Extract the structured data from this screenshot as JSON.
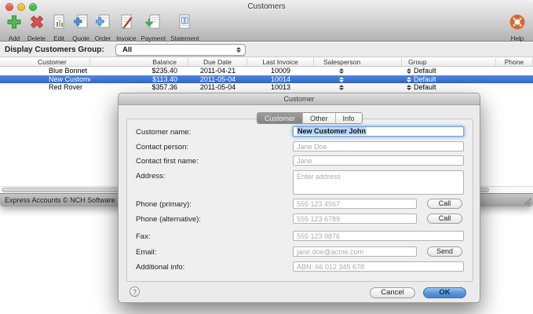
{
  "window": {
    "title": "Customers"
  },
  "toolbar": {
    "items": [
      {
        "label": "Add",
        "icon": "add-icon"
      },
      {
        "label": "Delete",
        "icon": "delete-icon"
      },
      {
        "label": "Edit",
        "icon": "edit-icon"
      },
      {
        "label": "Quote",
        "icon": "quote-icon"
      },
      {
        "label": "Order",
        "icon": "order-icon"
      },
      {
        "label": "Invoice",
        "icon": "invoice-icon"
      },
      {
        "label": "Payment",
        "icon": "payment-icon"
      },
      {
        "label": "Statement",
        "icon": "statement-icon"
      }
    ],
    "help": {
      "label": "Help",
      "icon": "help-lifesaver-icon"
    }
  },
  "filter": {
    "label": "Display Customers Group:",
    "value": "All"
  },
  "table": {
    "columns": [
      "Customer",
      "Balance",
      "Due Date",
      "Last Invoice",
      "Salesperson",
      "Group",
      "Phone"
    ],
    "rows": [
      {
        "customer": "Blue Bonnet",
        "balance": "$235.40",
        "due_date": "2011-04-21",
        "last_invoice": "10009",
        "group": "Default",
        "phone": "",
        "selected": false
      },
      {
        "customer": "New Customer John",
        "balance": "$113.40",
        "due_date": "2011-05-04",
        "last_invoice": "10014",
        "group": "Default",
        "phone": "",
        "selected": true
      },
      {
        "customer": "Red Rover",
        "balance": "$357.36",
        "due_date": "2011-05-04",
        "last_invoice": "10013",
        "group": "Default",
        "phone": "",
        "selected": false
      }
    ]
  },
  "status_bar": {
    "text": "Express Accounts © NCH Software"
  },
  "dialog": {
    "title": "Customer",
    "tabs": [
      {
        "label": "Customer",
        "active": true
      },
      {
        "label": "Other",
        "active": false
      },
      {
        "label": "Info",
        "active": false
      }
    ],
    "fields": {
      "customer_name": {
        "label": "Customer name:",
        "value": "New Customer John"
      },
      "contact_person": {
        "label": "Contact person:",
        "placeholder": "Jane Doe"
      },
      "contact_first_name": {
        "label": "Contact first name:",
        "placeholder": "Jane"
      },
      "address": {
        "label": "Address:",
        "placeholder": "Enter address"
      },
      "phone_primary": {
        "label": "Phone (primary):",
        "placeholder": "555 123 4567",
        "button": "Call"
      },
      "phone_alternative": {
        "label": "Phone (alternative):",
        "placeholder": "555 123 6789",
        "button": "Call"
      },
      "fax": {
        "label": "Fax:",
        "placeholder": "555 123 9876"
      },
      "email": {
        "label": "Email:",
        "placeholder": "jane.doe@acme.com",
        "button": "Send"
      },
      "additional_info": {
        "label": "Additional info:",
        "placeholder": "ABN: 66 012 345 678"
      }
    },
    "footer": {
      "help": "?",
      "cancel": "Cancel",
      "ok": "OK"
    }
  },
  "colors": {
    "selection_blue": "#3f76d6",
    "ok_button_blue": "#5a97d8",
    "text_selection_bg": "#b8d7fc",
    "help_ring_orange": "#e0702f",
    "add_green": "#55b455",
    "delete_red": "#d9534f"
  }
}
